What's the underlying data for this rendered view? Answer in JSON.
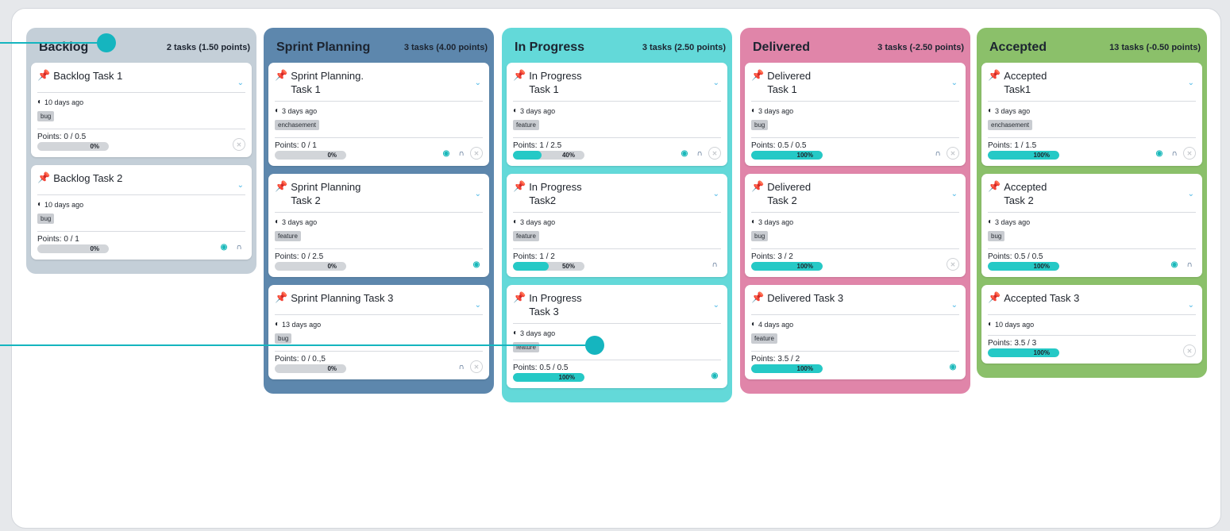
{
  "columns": [
    {
      "title": "Backlog",
      "count": "2 tasks (1.50 points)",
      "color": "#c4cfd8",
      "cards": [
        {
          "title": "Backlog Task 1",
          "time": "10 days ago",
          "tag": "bug",
          "points": "Points: 0 / 0.5",
          "progress": 0,
          "progress_label": "0%",
          "avatars": [
            "x"
          ]
        },
        {
          "title": "Backlog Task 2",
          "time": "10 days ago",
          "tag": "bug",
          "points": "Points: 0 / 1",
          "progress": 0,
          "progress_label": "0%",
          "avatars": [
            "v",
            "n"
          ]
        }
      ]
    },
    {
      "title": "Sprint Planning",
      "count": "3 tasks (4.00 points)",
      "color": "#5d87ad",
      "cards": [
        {
          "title": "Sprint Planning.\nTask 1",
          "time": "3 days ago",
          "tag": "enchasement",
          "points": "Points: 0 / 1",
          "progress": 0,
          "progress_label": "0%",
          "avatars": [
            "v",
            "n",
            "x"
          ]
        },
        {
          "title": "Sprint Planning\nTask 2",
          "time": "3 days ago",
          "tag": "feature",
          "points": "Points: 0 / 2.5",
          "progress": 0,
          "progress_label": "0%",
          "avatars": [
            "v"
          ]
        },
        {
          "title": "Sprint Planning Task 3",
          "time": "13 days ago",
          "tag": "bug",
          "points": "Points: 0 / 0.,5",
          "progress": 0,
          "progress_label": "0%",
          "avatars": [
            "n",
            "x"
          ]
        }
      ]
    },
    {
      "title": "In Progress",
      "count": "3 tasks (2.50 points)",
      "color": "#63d9d9",
      "cards": [
        {
          "title": "In Progress\nTask 1",
          "time": "3 days ago",
          "tag": "feature",
          "points": "Points: 1 / 2.5",
          "progress": 40,
          "progress_label": "40%",
          "avatars": [
            "v",
            "n",
            "x"
          ]
        },
        {
          "title": "In Progress\nTask2",
          "time": "3 days ago",
          "tag": "feature",
          "points": "Points: 1 / 2",
          "progress": 50,
          "progress_label": "50%",
          "avatars": [
            "n"
          ]
        },
        {
          "title": "In Progress\nTask 3",
          "time": "3 days ago",
          "tag": "feature",
          "points": "Points: 0.5 / 0.5",
          "progress": 100,
          "progress_label": "100%",
          "avatars": [
            "v"
          ]
        }
      ]
    },
    {
      "title": "Delivered",
      "count": "3 tasks (-2.50 points)",
      "color": "#e085a9",
      "cards": [
        {
          "title": "Delivered\nTask 1",
          "time": "3 days ago",
          "tag": "bug",
          "points": "Points: 0.5 / 0.5",
          "progress": 100,
          "progress_label": "100%",
          "avatars": [
            "n",
            "x"
          ]
        },
        {
          "title": "Delivered\nTask 2",
          "time": "3 days ago",
          "tag": "bug",
          "points": "Points: 3 / 2",
          "progress": 100,
          "progress_label": "100%",
          "avatars": [
            "x"
          ]
        },
        {
          "title": "Delivered Task 3",
          "time": "4 days ago",
          "tag": "feature",
          "points": "Points: 3.5 / 2",
          "progress": 100,
          "progress_label": "100%",
          "avatars": [
            "v"
          ]
        }
      ]
    },
    {
      "title": "Accepted",
      "count": "13 tasks (-0.50 points)",
      "color": "#8bc06a",
      "cards": [
        {
          "title": "Accepted\nTask1",
          "time": "3 days ago",
          "tag": "enchasement",
          "points": "Points: 1 / 1.5",
          "progress": 100,
          "progress_label": "100%",
          "avatars": [
            "v",
            "n",
            "x"
          ]
        },
        {
          "title": "Accepted\nTask 2",
          "time": "3 days ago",
          "tag": "bug",
          "points": "Points: 0.5 / 0.5",
          "progress": 100,
          "progress_label": "100%",
          "avatars": [
            "v",
            "n"
          ]
        },
        {
          "title": "Accepted Task 3",
          "time": "10 days ago",
          "tag": "",
          "points": "Points: 3.5 / 3",
          "progress": 100,
          "progress_label": "100%",
          "avatars": [
            "x"
          ]
        }
      ]
    }
  ],
  "icons": {
    "pin": "pin-icon",
    "clock": "clock-icon",
    "chevron": "chevron-down-icon"
  },
  "accent_color": "#15b5bf"
}
